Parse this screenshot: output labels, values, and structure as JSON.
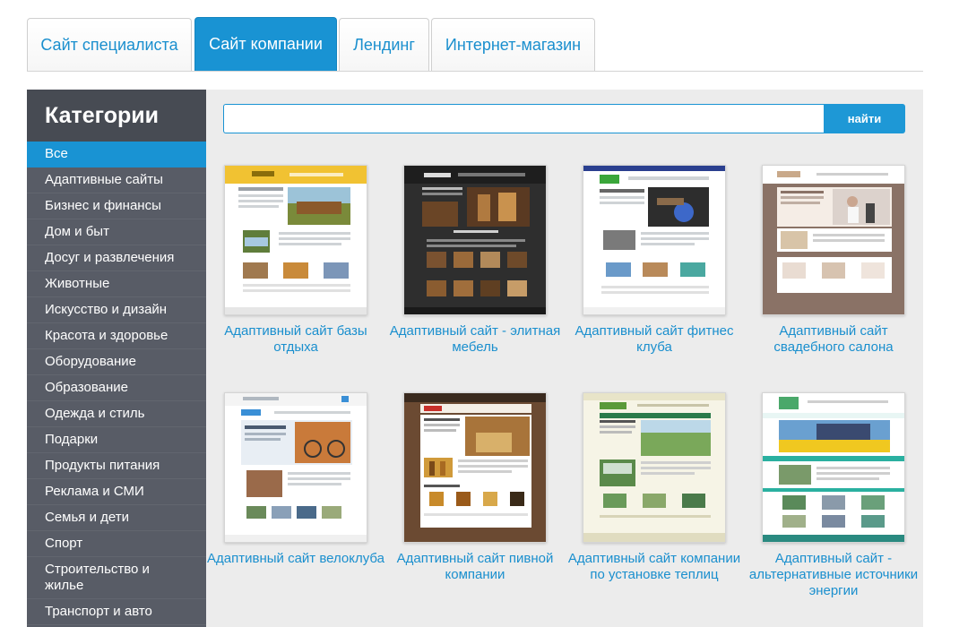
{
  "tabs": [
    {
      "label": "Сайт специалиста"
    },
    {
      "label": "Сайт компании"
    },
    {
      "label": "Лендинг"
    },
    {
      "label": "Интернет-магазин"
    }
  ],
  "active_tab": "Сайт компании",
  "sidebar": {
    "title": "Категории",
    "items": [
      {
        "label": "Все"
      },
      {
        "label": "Адаптивные сайты"
      },
      {
        "label": "Бизнес и финансы"
      },
      {
        "label": "Дом и быт"
      },
      {
        "label": "Досуг и развлечения"
      },
      {
        "label": "Животные"
      },
      {
        "label": "Искусство и дизайн"
      },
      {
        "label": "Красота и здоровье"
      },
      {
        "label": "Оборудование"
      },
      {
        "label": "Образование"
      },
      {
        "label": "Одежда и стиль"
      },
      {
        "label": "Подарки"
      },
      {
        "label": "Продукты питания"
      },
      {
        "label": "Реклама и СМИ"
      },
      {
        "label": "Семья и дети"
      },
      {
        "label": "Спорт"
      },
      {
        "label": "Строительство и жилье"
      },
      {
        "label": "Транспорт и авто"
      }
    ],
    "active_item": "Все"
  },
  "search": {
    "value": "",
    "placeholder": "",
    "button_label": "найти"
  },
  "templates": [
    {
      "title": "Адаптивный сайт базы отдыха"
    },
    {
      "title": "Адаптивный сайт - элитная мебель"
    },
    {
      "title": "Адаптивный сайт фитнес клуба"
    },
    {
      "title": "Адаптивный сайт свадебного салона"
    },
    {
      "title": "Адаптивный сайт велоклуба"
    },
    {
      "title": "Адаптивный сайт пивной компании"
    },
    {
      "title": "Адаптивный сайт компании по установке теплиц"
    },
    {
      "title": "Адаптивный сайт - альтернативные источники энергии"
    }
  ],
  "colors": {
    "accent": "#1993d3",
    "link": "#1a8fce",
    "sidebar_bg": "#585c66",
    "content_bg": "#ececec"
  }
}
